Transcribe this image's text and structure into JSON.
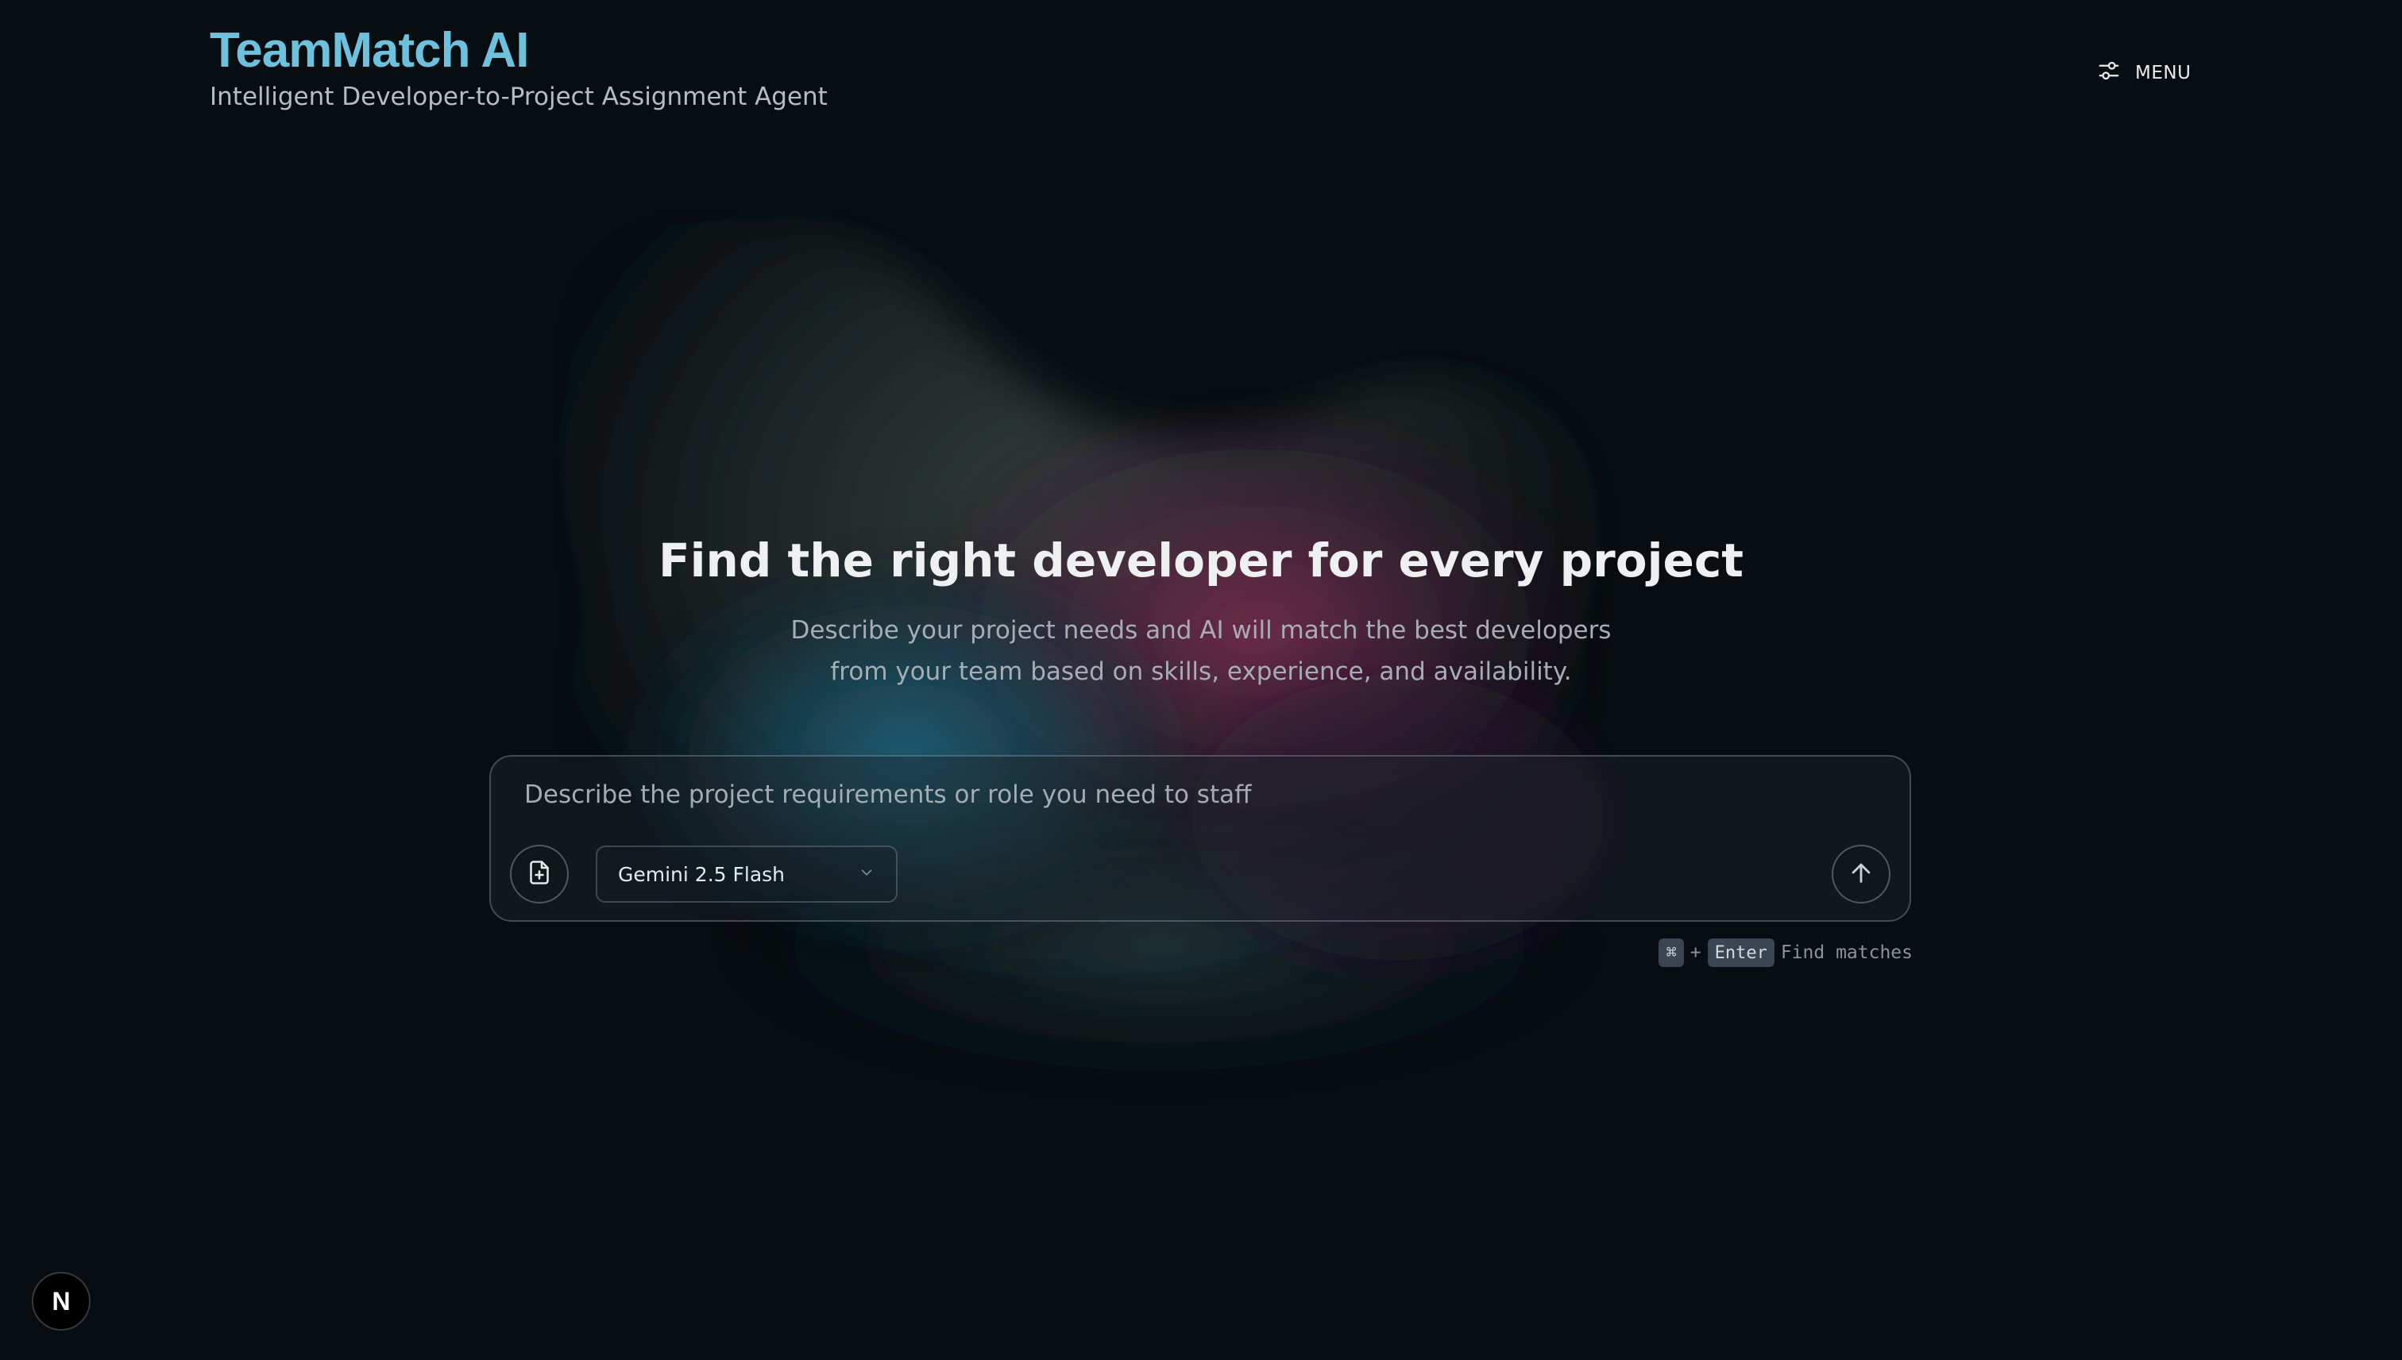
{
  "header": {
    "title": "TeamMatch AI",
    "subtitle": "Intelligent Developer-to-Project Assignment Agent",
    "menu_label": "MENU",
    "menu_icon": "sliders-icon"
  },
  "hero": {
    "title": "Find the right developer for every project",
    "description_line1": "Describe your project needs and AI will match the best developers",
    "description_line2": "from your team based on skills, experience, and availability."
  },
  "prompt": {
    "placeholder": "Describe the project requirements or role you need to staff",
    "value": "",
    "attach_icon": "file-plus-icon",
    "model_selected": "Gemini 2.5 Flash",
    "model_icon": "chevron-down-icon",
    "send_icon": "arrow-up-icon"
  },
  "shortcut": {
    "modifier": "⌘",
    "plus": "+",
    "key": "Enter",
    "action": "Find matches"
  },
  "badge": {
    "letter": "N"
  },
  "colors": {
    "background": "#070d11",
    "brand": "#6ec1dd",
    "text_primary": "#eef0f2",
    "text_muted": "#a6adb4"
  }
}
